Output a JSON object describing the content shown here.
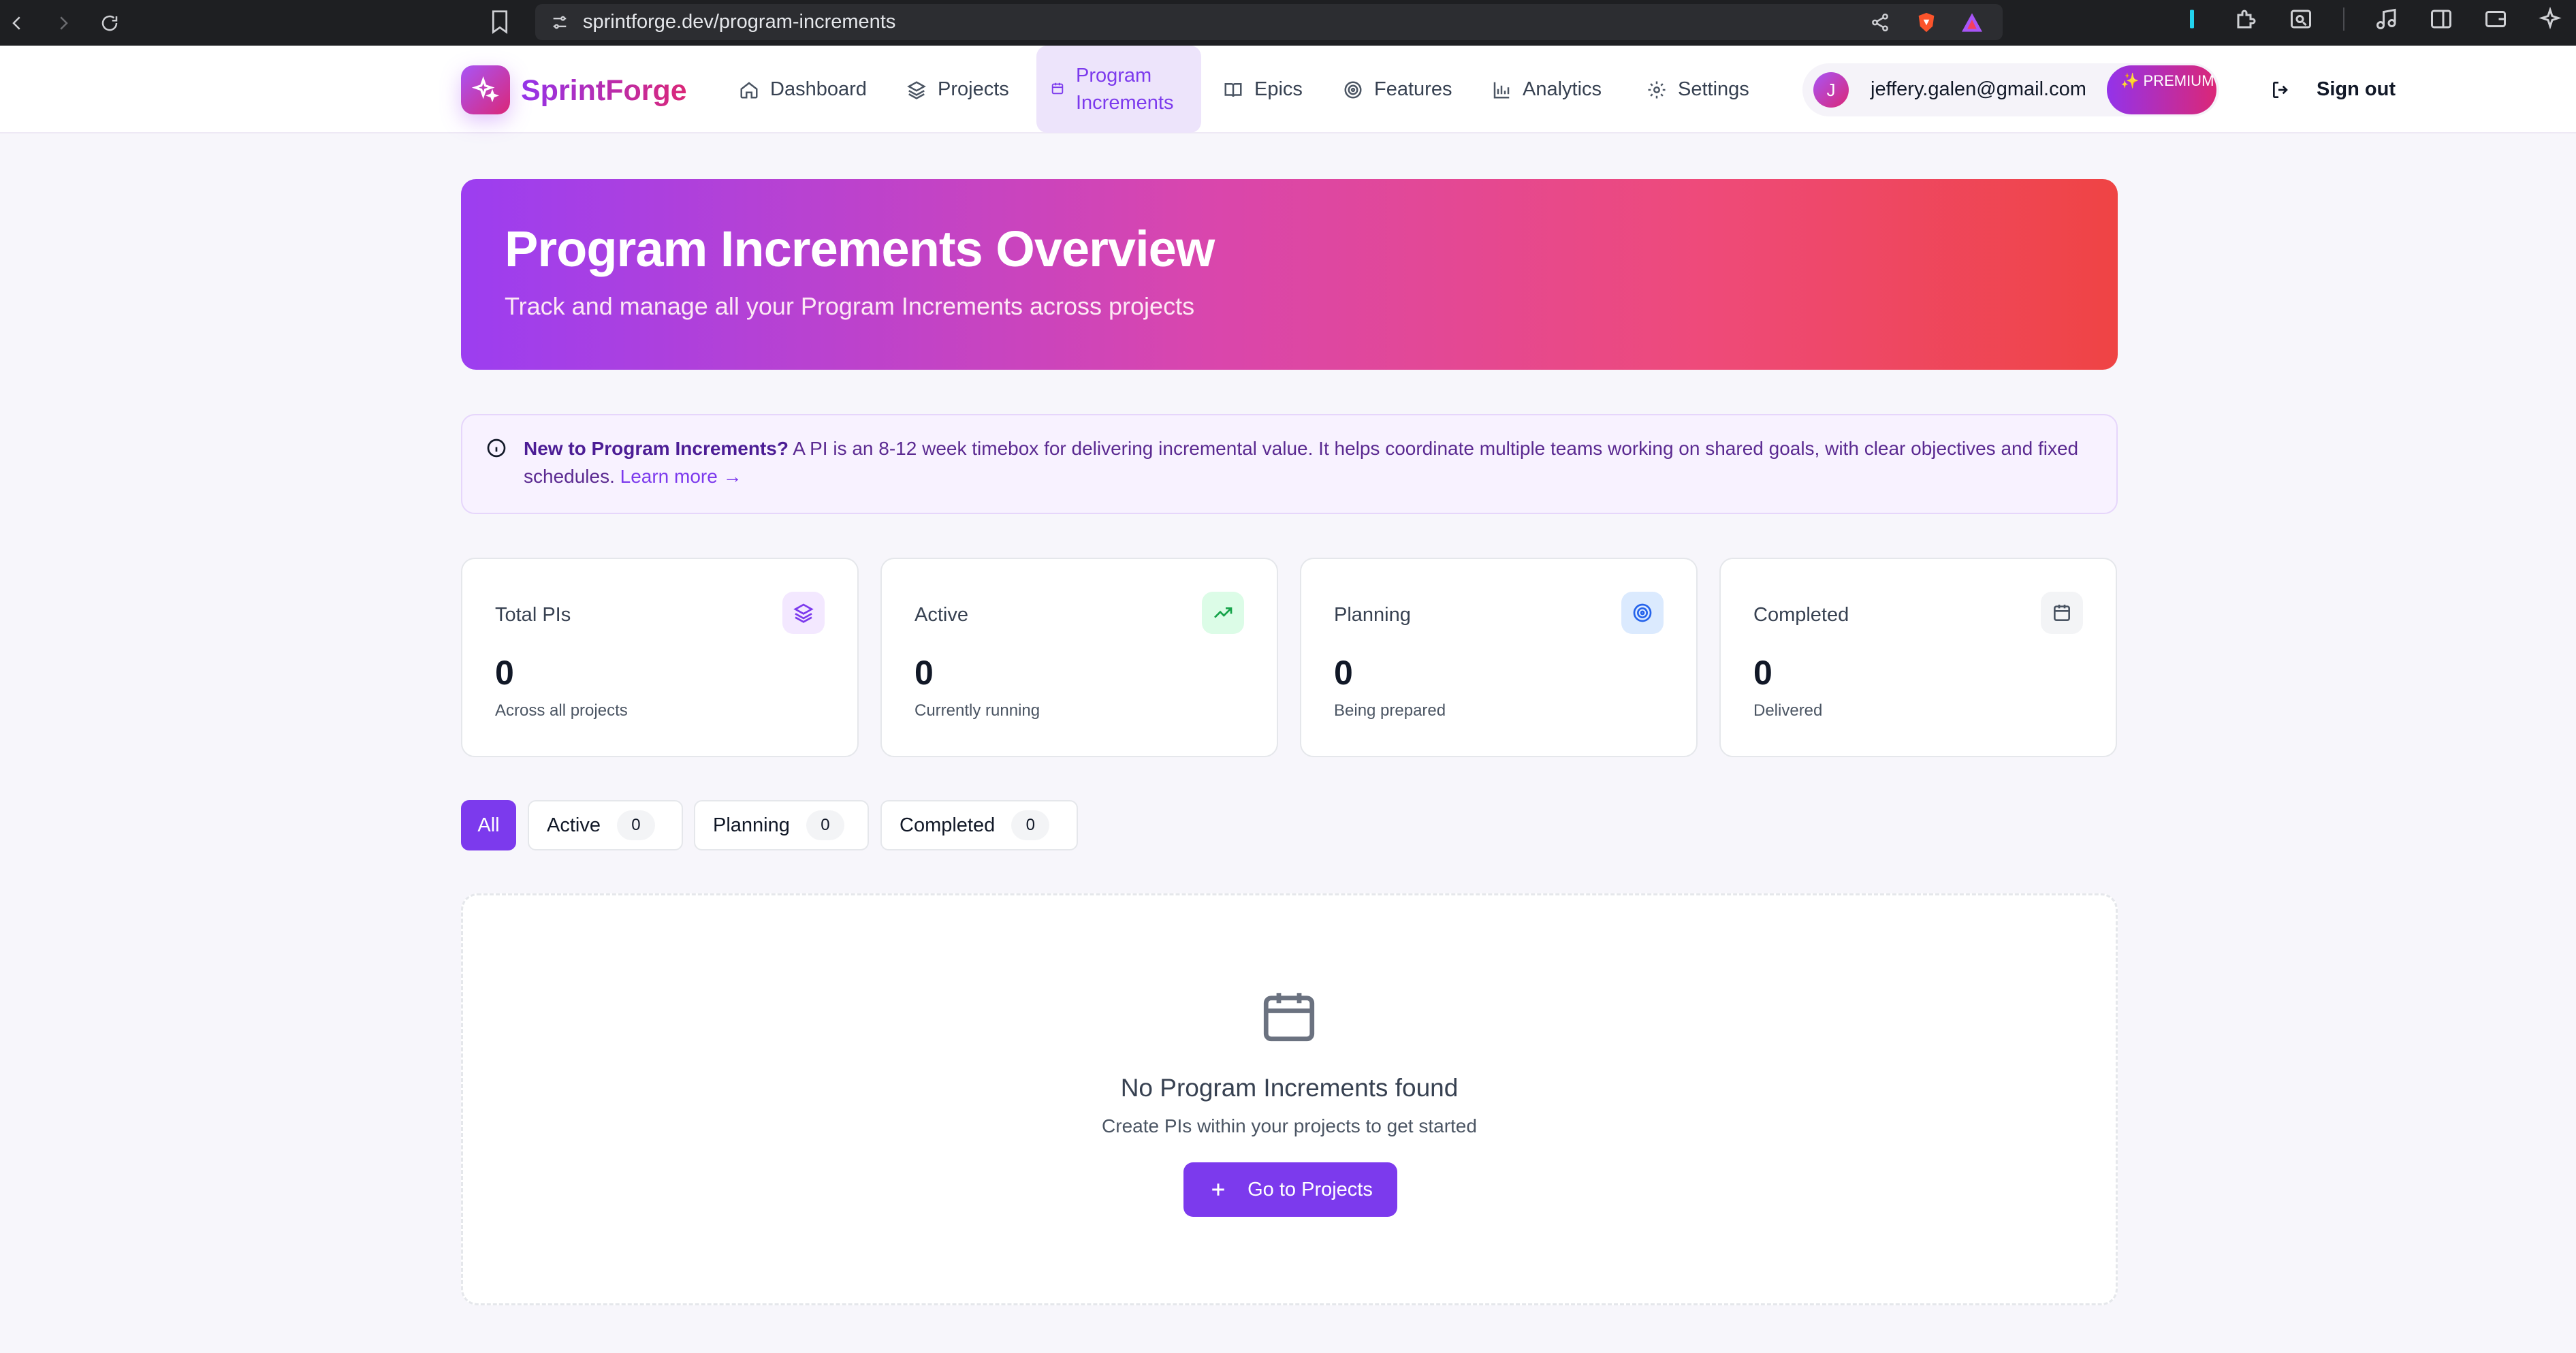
{
  "browser": {
    "url": "sprintforge.dev/program-increments"
  },
  "header": {
    "brand": "SprintForge",
    "nav": [
      {
        "label": "Dashboard",
        "icon": "home-icon"
      },
      {
        "label": "Projects",
        "icon": "layers-icon"
      },
      {
        "label": "Program Increments",
        "icon": "calendar-icon",
        "active": true
      },
      {
        "label": "Epics",
        "icon": "book-icon"
      },
      {
        "label": "Features",
        "icon": "target-icon"
      },
      {
        "label": "Analytics",
        "icon": "bar-chart-icon"
      },
      {
        "label": "Settings",
        "icon": "gear-icon"
      }
    ],
    "user": {
      "initial": "J",
      "email": "jeffery.galen@gmail.com",
      "badge": "✨ PREMIUM"
    },
    "signout_label": "Sign out"
  },
  "hero": {
    "title": "Program Increments Overview",
    "subtitle": "Track and manage all your Program Increments across projects"
  },
  "info": {
    "title": "New to Program Increments?",
    "text": " A PI is an 8-12 week timebox for delivering incremental value. It helps coordinate multiple teams working on shared goals, with clear objectives and fixed schedules. ",
    "link": "Learn more →"
  },
  "stats": [
    {
      "label": "Total PIs",
      "value": "0",
      "sub": "Across all projects",
      "icon": "layers-icon",
      "color": "#7c3aed"
    },
    {
      "label": "Active",
      "value": "0",
      "sub": "Currently running",
      "icon": "trending-up-icon",
      "color": "#16a34a"
    },
    {
      "label": "Planning",
      "value": "0",
      "sub": "Being prepared",
      "icon": "target-icon",
      "color": "#2563eb"
    },
    {
      "label": "Completed",
      "value": "0",
      "sub": "Delivered",
      "icon": "calendar-icon",
      "color": "#4b5563"
    }
  ],
  "filters": [
    {
      "label": "All"
    },
    {
      "label": "Active",
      "count": "0"
    },
    {
      "label": "Planning",
      "count": "0"
    },
    {
      "label": "Completed",
      "count": "0"
    }
  ],
  "empty": {
    "title": "No Program Increments found",
    "subtitle": "Create PIs within your projects to get started",
    "button": "Go to Projects"
  },
  "colors": {
    "accent": "#7c3aed",
    "hero_start": "#9c3ef0",
    "hero_end": "#ef4444"
  }
}
